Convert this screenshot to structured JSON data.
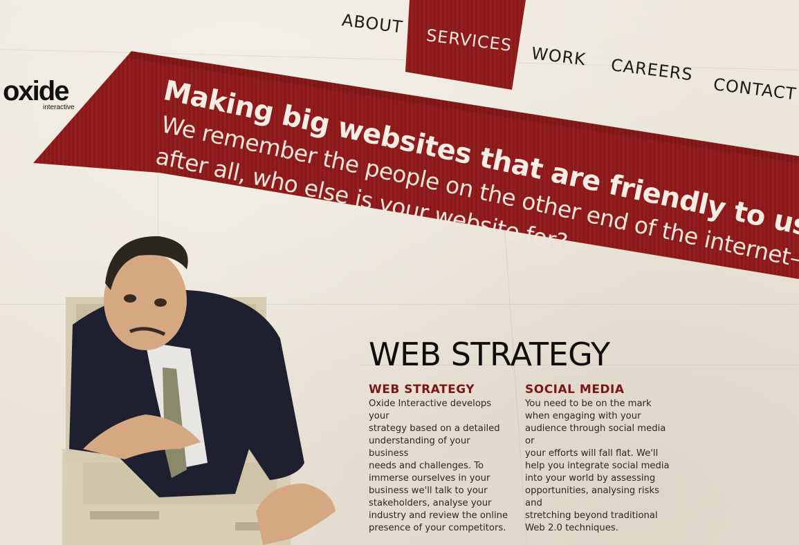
{
  "brand": {
    "logo_text": "oxide",
    "logo_sub": "interactive"
  },
  "nav": {
    "items": [
      {
        "label": "ABOUT",
        "active": false
      },
      {
        "label": "SERVICES",
        "active": true
      },
      {
        "label": "WORK",
        "active": false
      },
      {
        "label": "CAREERS",
        "active": false
      },
      {
        "label": "CONTACT",
        "active": false
      }
    ]
  },
  "hero": {
    "headline": "Making big websites that are friendly to use.",
    "subline_1": "We remember the people on the other end of the internet—",
    "subline_2": "after all, who else is your website for?"
  },
  "section": {
    "title": "WEB STRATEGY",
    "columns": [
      {
        "heading": "WEB STRATEGY",
        "lines": [
          "Oxide Interactive develops your",
          "strategy based on a detailed",
          "understanding of your business",
          "needs and challenges. To",
          "immerse ourselves in your",
          "business we'll talk to your",
          "stakeholders, analyse your",
          "industry and review the online",
          "presence of your competitors."
        ]
      },
      {
        "heading": "SOCIAL MEDIA",
        "lines": [
          "You need to be on the mark",
          "when engaging with your",
          "audience through social media or",
          "your efforts will fall flat. We'll",
          "help you integrate social media",
          "into your world by assessing",
          "opportunities, analysing risks and",
          "stretching beyond traditional",
          "Web 2.0 techniques."
        ]
      }
    ]
  },
  "colors": {
    "accent": "#8b1a1a",
    "heading_red": "#7c1616",
    "background": "#ece6da",
    "text": "#2b2724"
  }
}
